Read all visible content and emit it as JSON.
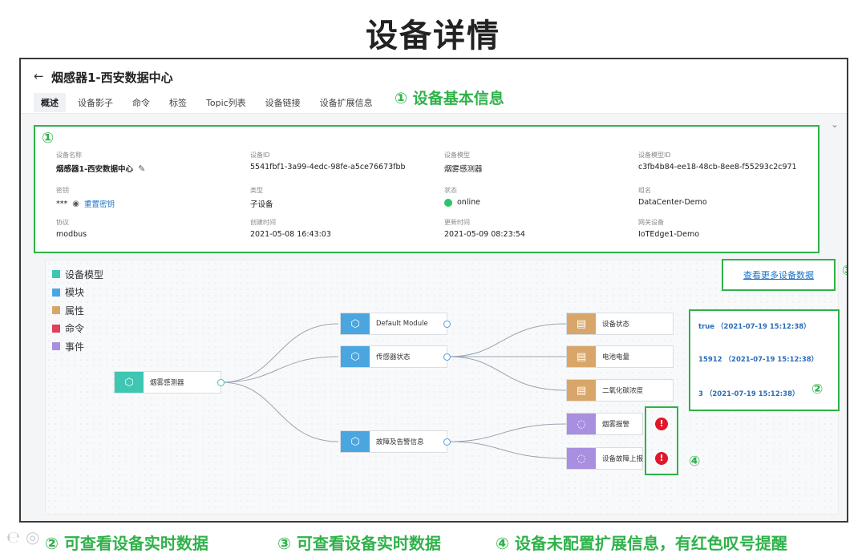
{
  "slide_title": "设备详情",
  "header": {
    "back_label": "←",
    "title": "烟感器1-西安数据中心"
  },
  "tabs": [
    "概述",
    "设备影子",
    "命令",
    "标签",
    "Topic列表",
    "设备链接",
    "设备扩展信息"
  ],
  "callouts": {
    "c1": "① 设备基本信息",
    "c1_badge": "①",
    "c2_badge": "②",
    "c3_badge": "③",
    "c4_badge": "④"
  },
  "info": {
    "device_name_label": "设备名称",
    "device_name": "烟感器1-西安数据中心",
    "device_id_label": "设备ID",
    "device_id": "5541fbf1-3a99-4edc-98fe-a5ce76673fbb",
    "model_label": "设备模型",
    "model": "烟雾感测器",
    "model_id_label": "设备模型ID",
    "model_id": "c3fb4b84-ee18-48cb-8ee8-f55293c2c971",
    "key_label": "密钥",
    "key_masked": "***",
    "key_reset": "重置密钥",
    "type_label": "类型",
    "type": "子设备",
    "status_label": "状态",
    "status": "online",
    "group_label": "组名",
    "group": "DataCenter-Demo",
    "protocol_label": "协议",
    "protocol": "modbus",
    "created_label": "创建时间",
    "created": "2021-05-08 16:43:03",
    "updated_label": "更新时间",
    "updated": "2021-05-09 08:23:54",
    "gateway_label": "网关设备",
    "gateway": "IoTEdge1-Demo"
  },
  "legend": [
    {
      "label": "设备模型",
      "color": "#3ec6b3"
    },
    {
      "label": "模块",
      "color": "#4ba6e0"
    },
    {
      "label": "属性",
      "color": "#d9a66a"
    },
    {
      "label": "命令",
      "color": "#e0415b"
    },
    {
      "label": "事件",
      "color": "#a98fe0"
    }
  ],
  "more_data_link": "查看更多设备数据",
  "nodes": {
    "root": "烟雾感测器",
    "module1": "Default Module",
    "module2": "传感器状态",
    "module3": "故障及告警信息",
    "prop1": "设备状态",
    "prop2": "电池电量",
    "prop3": "二氧化碳浓度",
    "event1": "烟雾报警",
    "event2": "设备故障上报"
  },
  "realtime_values": [
    "true  （2021-07-19 15:12:38）",
    "15912  （2021-07-19 15:12:38）",
    "3  （2021-07-19 15:12:38）"
  ],
  "alert_symbol": "!",
  "bottom": {
    "c2": "② 可查看设备实时数据",
    "c3": "③ 可查看设备实时数据",
    "c4": "④ 设备未配置扩展信息，有红色叹号提醒"
  },
  "colors": {
    "accent_green": "#2fb24a",
    "link_blue": "#1a73c8",
    "alert_red": "#e0172b"
  }
}
